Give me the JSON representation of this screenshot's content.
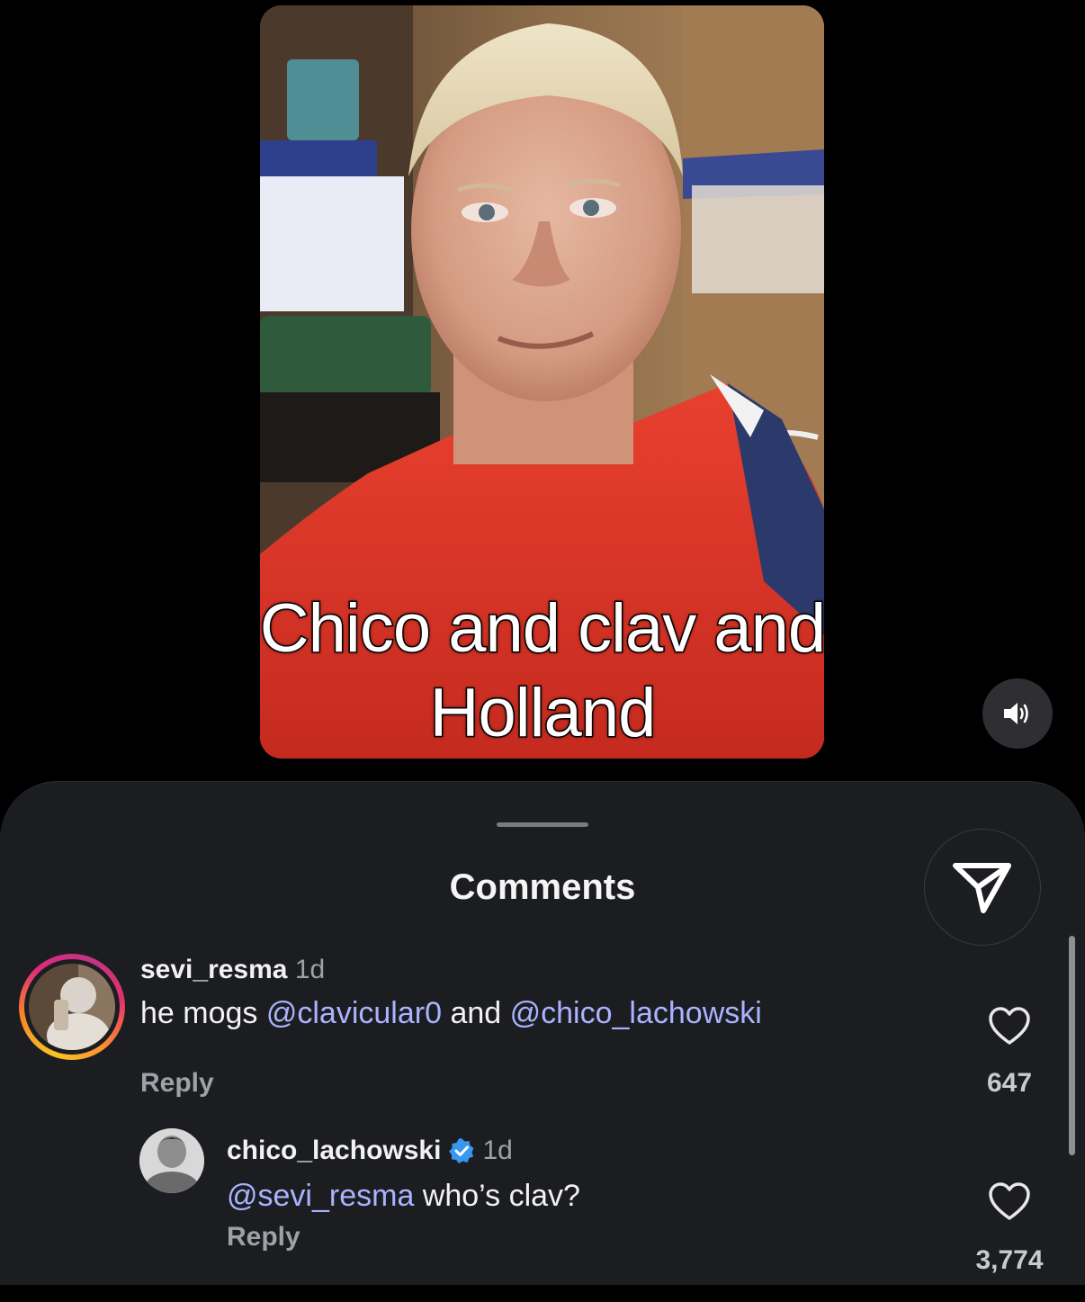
{
  "video": {
    "caption_line1": "Chico and clav and",
    "caption_line2": "Holland",
    "volume_icon": "speaker-on-icon"
  },
  "comments_sheet": {
    "title": "Comments",
    "share_icon": "send-icon",
    "comments": [
      {
        "username": "sevi_resma",
        "time": "1d",
        "text_prefix": "he mogs ",
        "mention1": "@clavicular0",
        "text_middle": " and ",
        "mention2": "@chico_lachowski",
        "reply_label": "Reply",
        "likes": "647",
        "has_story_ring": true
      },
      {
        "username": "chico_lachowski",
        "verified": true,
        "time": "1d",
        "mention": "@sevi_resma",
        "text": " who’s clav?",
        "reply_label": "Reply",
        "likes": "3,774"
      }
    ]
  },
  "colors": {
    "sheet_bg": "#1c1d20",
    "mention": "#a9b3ff",
    "verified_badge": "#3897f0",
    "secondary_text": "#a0a1a6"
  }
}
